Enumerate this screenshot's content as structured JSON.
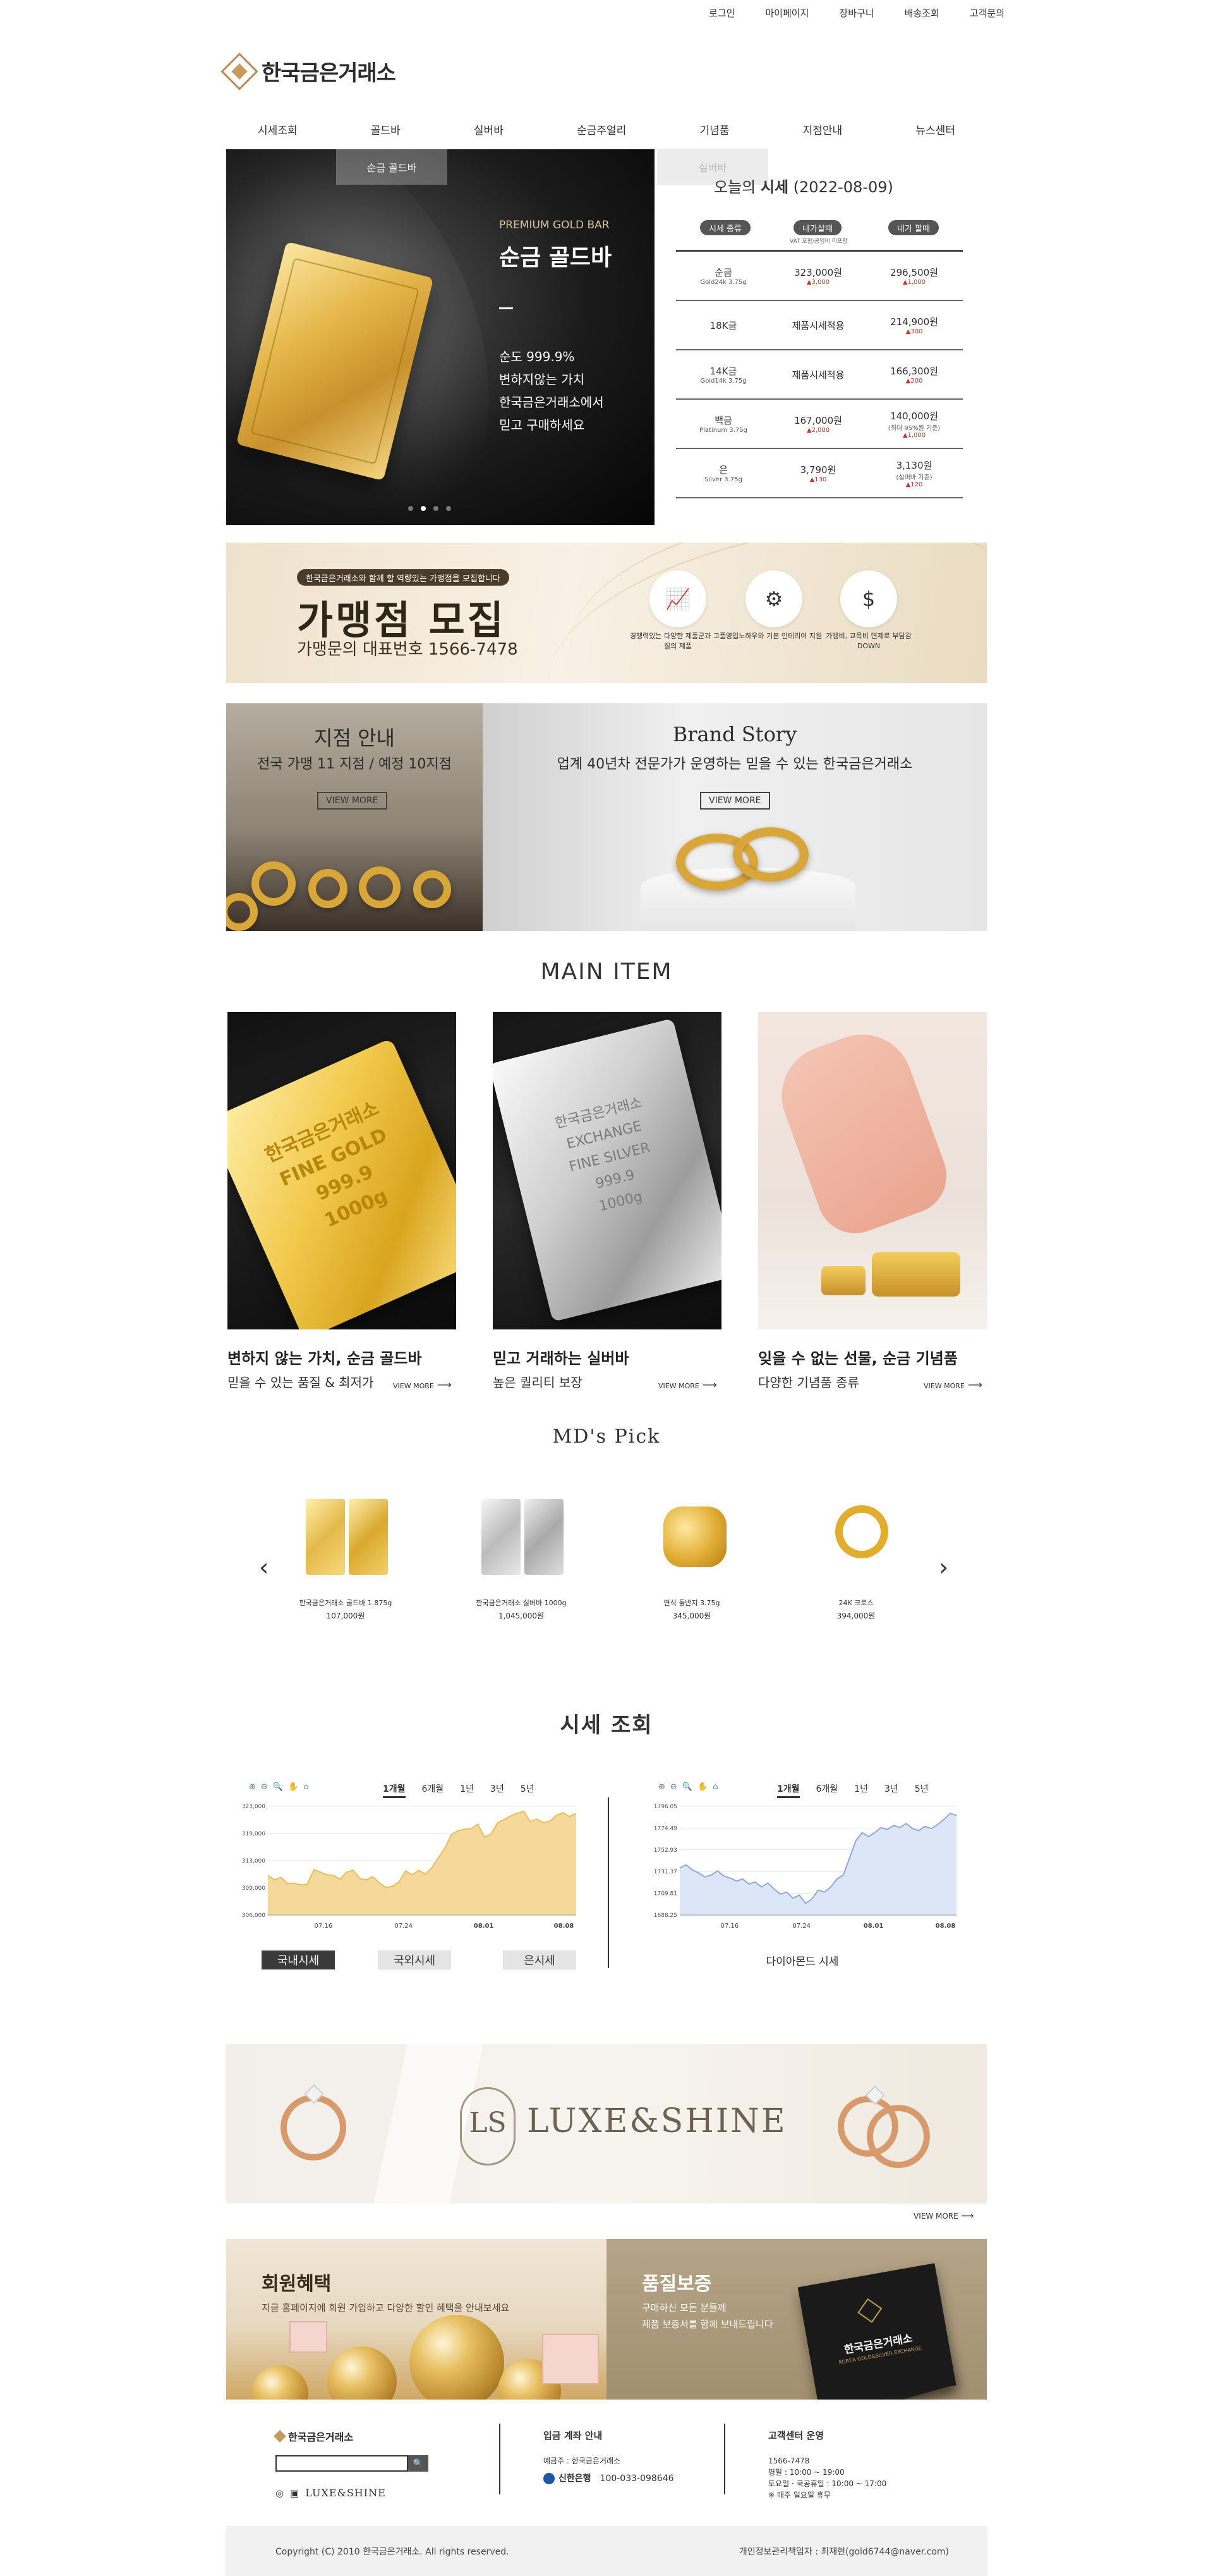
{
  "top_links": [
    "로그인",
    "마이페이지",
    "장바구니",
    "배송조회",
    "고객문의"
  ],
  "brand": {
    "name": "한국금은거래소"
  },
  "nav": [
    "시세조회",
    "골드바",
    "실버바",
    "순금주얼리",
    "기념품",
    "지점안내",
    "뉴스센터"
  ],
  "hero": {
    "tab_left": "순금 골드바",
    "tab_right": "실버바",
    "sub": "PREMIUM GOLD BAR",
    "title": "순금 골드바",
    "desc": [
      "순도 999.9%",
      "변하지않는 가치",
      "한국금은거래소에서",
      "믿고 구매하세요"
    ],
    "dots": 4,
    "active_dot": 2
  },
  "price_table": {
    "title_prefix": "오늘의 ",
    "title_bold": "시세",
    "title_date": " (2022-08-09)",
    "headers": [
      "시세 종류",
      "내가살때",
      "내가 팔때"
    ],
    "header_hint": "VAT 포함/공임비 미포함",
    "rows": [
      {
        "name": "순금",
        "sub": "Gold24k 3.75g",
        "buy": "323,000원",
        "buy_change": "▲3,000",
        "sell": "296,500원",
        "sell_change": "▲1,000",
        "sell_note": ""
      },
      {
        "name": "18K금",
        "sub": "",
        "buy": "제품시세적용",
        "buy_change": "",
        "sell": "214,900원",
        "sell_change": "▲300",
        "sell_note": ""
      },
      {
        "name": "14K금",
        "sub": "Gold14k 3.75g",
        "buy": "제품시세적용",
        "buy_change": "",
        "sell": "166,300원",
        "sell_change": "▲200",
        "sell_note": ""
      },
      {
        "name": "백금",
        "sub": "Platinum 3.75g",
        "buy": "167,000원",
        "buy_change": "▲2,000",
        "sell": "140,000원",
        "sell_change": "▲1,000",
        "sell_note": "(최대 95%원 기준)"
      },
      {
        "name": "은",
        "sub": "Silver 3.75g",
        "buy": "3,790원",
        "buy_change": "▲130",
        "sell": "3,130원",
        "sell_change": "▲120",
        "sell_note": "(실버바 기준)"
      }
    ]
  },
  "franchise": {
    "tag": "한국금은거래소와 함께 할 역량있는 가맹점을 모집합니다",
    "title": "가맹점 모집",
    "phone": "가맹문의 대표번호  1566-7478",
    "features": [
      {
        "icon": "chart-board-icon",
        "glyph": "📈",
        "caption": "경쟁력있는 다양한 제품군과 고품질의 제품"
      },
      {
        "icon": "gear-icon",
        "glyph": "⚙",
        "caption": "영업노하우와 기본 인테리어 지원"
      },
      {
        "icon": "money-icon",
        "glyph": "$",
        "caption": "가맹비, 교육비 면제로 부담감 DOWN"
      }
    ]
  },
  "store": {
    "title": "지점 안내",
    "sub": "전국 가맹 11 지점 / 예정 10지점",
    "more": "VIEW MORE"
  },
  "brand_story": {
    "title": "Brand Story",
    "sub": "업계 40년차 전문가가 운영하는 믿을 수 있는 한국금은거래소",
    "more": "VIEW MORE"
  },
  "main_item": {
    "title": "MAIN ITEM",
    "items": [
      {
        "title": "변하지 않는 가치, 순금 골드바",
        "sub": "믿을 수 있는 품질 & 최저가",
        "more": "VIEW MORE",
        "bar_lines": [
          "한국금은거래소",
          "FINE GOLD",
          "999.9",
          "1000g"
        ]
      },
      {
        "title": "믿고 거래하는 실버바",
        "sub": "높은 퀄리티 보장",
        "more": "VIEW MORE",
        "bar_lines": [
          "한국금은거래소",
          "EXCHANGE",
          "FINE SILVER",
          "999.9",
          "1000g"
        ]
      },
      {
        "title": "잊을 수 없는 선물, 순금 기념품",
        "sub": "다양한 기념품 종류",
        "more": "VIEW MORE"
      }
    ]
  },
  "md_pick": {
    "title": "MD's Pick",
    "prev": "‹",
    "next": "›",
    "items": [
      {
        "name": "한국금은거래소 골드바 1.875g",
        "price": "107,000원"
      },
      {
        "name": "한국금은거래소 실버바 1000g",
        "price": "1,045,000원"
      },
      {
        "name": "연식 돌반지 3.75g",
        "price": "345,000원"
      },
      {
        "name": "24K 크로스",
        "price": "394,000원"
      }
    ]
  },
  "price_graph": {
    "title": "시세 조회",
    "periods": [
      "1개월",
      "6개월",
      "1년",
      "3년",
      "5년"
    ],
    "selected_period": "1개월",
    "tool_icons": [
      "zoom-in-icon",
      "zoom-out-icon",
      "search-icon",
      "pan-icon",
      "home-icon"
    ],
    "buttons": [
      "국내시세",
      "국외시세",
      "은시세"
    ],
    "active_button": "국내시세",
    "right_label": "다이아몬드 시세",
    "colors": {
      "gold_fill": "#f5d99a",
      "gold_line": "#e7bd5e",
      "blue_fill": "#dde6f7",
      "blue_line": "#8fa8dc"
    }
  },
  "chart_data": [
    {
      "type": "area",
      "title": "",
      "x_ticks": [
        "07.16",
        "07.24",
        "08.01",
        "08.08"
      ],
      "bold_ticks": [
        "08.01",
        "08.08"
      ],
      "y_ticks": [
        "323,000",
        "319,000",
        "313,000",
        "309,000",
        "306,000"
      ],
      "ylim": [
        306000,
        323000
      ],
      "values": [
        312200,
        311500,
        311900,
        310900,
        311000,
        310700,
        310800,
        313100,
        312700,
        312300,
        312200,
        311600,
        312700,
        313000,
        311700,
        311500,
        312000,
        311000,
        310300,
        310500,
        311200,
        312900,
        312300,
        313000,
        312400,
        313400,
        315000,
        316500,
        318600,
        319200,
        319400,
        319500,
        320200,
        318200,
        318600,
        320400,
        320900,
        321500,
        321900,
        322200,
        320600,
        321000,
        320400,
        320700,
        321600,
        322000,
        321400,
        321900
      ],
      "grid": true
    },
    {
      "type": "area",
      "title": "",
      "x_ticks": [
        "07.16",
        "07.24",
        "08.01",
        "08.08"
      ],
      "bold_ticks": [
        "08.01",
        "08.08"
      ],
      "y_ticks": [
        "1796.05",
        "1774.49",
        "1752.93",
        "1731.37",
        "1709.81",
        "1688.25"
      ],
      "ylim": [
        1688.25,
        1796.05
      ],
      "values": [
        1735,
        1738,
        1733,
        1730,
        1726,
        1728,
        1732,
        1727,
        1725,
        1722,
        1724,
        1719,
        1721,
        1716,
        1720,
        1714,
        1709,
        1711,
        1705,
        1708,
        1700,
        1704,
        1713,
        1711,
        1716,
        1724,
        1728,
        1745,
        1762,
        1770,
        1766,
        1770,
        1775,
        1773,
        1777,
        1775,
        1779,
        1774,
        1772,
        1776,
        1774,
        1778,
        1783,
        1789,
        1787
      ],
      "grid": true
    }
  ],
  "luxe": {
    "emblem": "LS",
    "text": "LUXE&SHINE",
    "more": "VIEW MORE"
  },
  "benefit": {
    "title": "회원혜택",
    "desc": "지금 홈페이지에 회원 가입하고 다양한 할인 혜택을 안내보세요"
  },
  "guarantee": {
    "title": "품질보증",
    "desc": [
      "구매하신 모든 분들께",
      "제품 보증서를 함께 보내드립니다"
    ],
    "card_text": "한국금은거래소",
    "card_sub": "KOREA GOLD&SILVER EXCHANGE"
  },
  "footer": {
    "logo": "한국금은거래소",
    "search_btn": "🔍",
    "luxe": "LUXE&SHINE",
    "account_title": "입금 계좌 안내",
    "account_holder": "예금주 : 한국금은거래소",
    "bank": "신한은행",
    "account_no": "100-033-098646",
    "cs_title": "고객센터 운영",
    "cs_lines": [
      "1566-7478",
      "평일 : 10:00 ~ 19:00",
      "토요일 · 국공휴일 : 10:00 ~ 17:00",
      "※ 매주 일요일 휴무"
    ],
    "copyright": "Copyright (C) 2010 한국금은거래소. All rights reserved.",
    "privacy": "개인정보관리책임자 : 최재현(gold6744@naver.com)"
  }
}
